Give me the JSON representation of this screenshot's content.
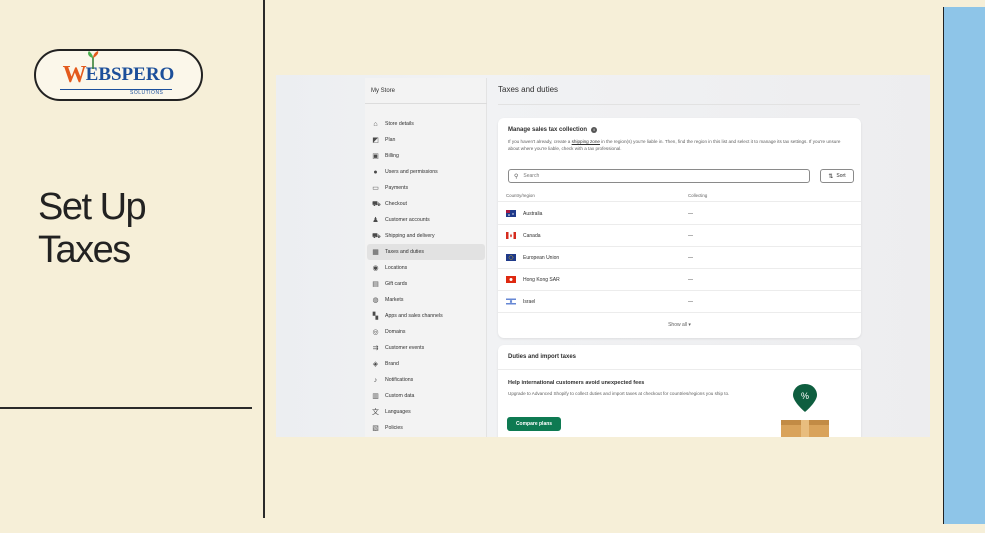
{
  "brand": {
    "logo_letter": "W",
    "logo_rest": "EBSPERO",
    "logo_sub": "SOLUTIONS"
  },
  "slide": {
    "title": "Set Up Taxes"
  },
  "colors": {
    "background": "#f6efd8",
    "accent_panel": "#8ec5e8",
    "primary_button": "#0e7a52"
  },
  "app": {
    "store_name": "My Store",
    "nav": [
      {
        "label": "Store details",
        "icon": "store-icon"
      },
      {
        "label": "Plan",
        "icon": "plan-icon"
      },
      {
        "label": "Billing",
        "icon": "billing-icon"
      },
      {
        "label": "Users and permissions",
        "icon": "user-icon"
      },
      {
        "label": "Payments",
        "icon": "payments-icon"
      },
      {
        "label": "Checkout",
        "icon": "cart-icon"
      },
      {
        "label": "Customer accounts",
        "icon": "person-icon"
      },
      {
        "label": "Shipping and delivery",
        "icon": "truck-icon"
      },
      {
        "label": "Taxes and duties",
        "icon": "tax-icon",
        "active": true
      },
      {
        "label": "Locations",
        "icon": "location-icon"
      },
      {
        "label": "Gift cards",
        "icon": "gift-icon"
      },
      {
        "label": "Markets",
        "icon": "globe-icon"
      },
      {
        "label": "Apps and sales channels",
        "icon": "apps-icon"
      },
      {
        "label": "Domains",
        "icon": "domain-icon"
      },
      {
        "label": "Customer events",
        "icon": "events-icon"
      },
      {
        "label": "Brand",
        "icon": "brand-icon"
      },
      {
        "label": "Notifications",
        "icon": "bell-icon"
      },
      {
        "label": "Custom data",
        "icon": "data-icon"
      },
      {
        "label": "Languages",
        "icon": "language-icon"
      },
      {
        "label": "Policies",
        "icon": "policy-icon"
      }
    ],
    "page_title": "Taxes and duties",
    "sales_tax": {
      "heading": "Manage sales tax collection",
      "desc_pre": "If you haven't already, create a ",
      "desc_link": "shipping zone",
      "desc_post": " in the region(s) you're liable in. Then, find the region in this list and select it to manage its tax settings. If you're unsure about where you're liable, check with a tax professional.",
      "search_placeholder": "Search",
      "sort_label": "Sort",
      "col_country": "Country/region",
      "col_collecting": "Collecting",
      "rows": [
        {
          "name": "Australia",
          "collecting": "—"
        },
        {
          "name": "Canada",
          "collecting": "—"
        },
        {
          "name": "European Union",
          "collecting": "—"
        },
        {
          "name": "Hong Kong SAR",
          "collecting": "—"
        },
        {
          "name": "Israel",
          "collecting": "—"
        }
      ],
      "show_all": "Show all ▾"
    },
    "duties": {
      "heading": "Duties and import taxes",
      "subheading": "Help international customers avoid unexpected fees",
      "desc": "Upgrade to Advanced Shopify to collect duties and import taxes at checkout for countries/regions you ship to.",
      "button": "Compare plans"
    }
  }
}
